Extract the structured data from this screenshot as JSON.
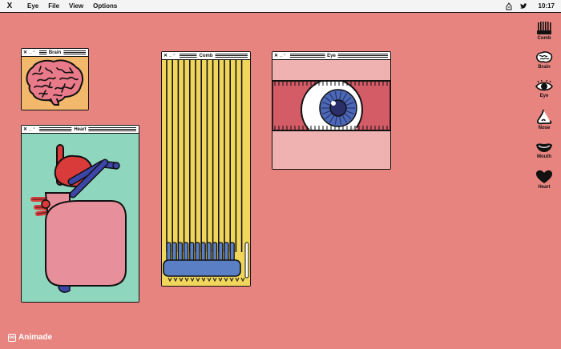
{
  "menubar": {
    "logo_glyph": "X",
    "menus": [
      "Eye",
      "File",
      "View",
      "Options"
    ],
    "clock": "10:17",
    "icons": [
      "recycle-icon",
      "twitter-icon"
    ]
  },
  "windows": {
    "brain": {
      "title": "Brain"
    },
    "heart": {
      "title": "Heart"
    },
    "comb": {
      "title": "Comb"
    },
    "eye": {
      "title": "Eye"
    }
  },
  "dock": {
    "items": [
      {
        "label": "Comb",
        "icon": "comb-icon"
      },
      {
        "label": "Brain",
        "icon": "brain-icon"
      },
      {
        "label": "Eye",
        "icon": "eye-icon"
      },
      {
        "label": "Nose",
        "icon": "nose-icon"
      },
      {
        "label": "Mouth",
        "icon": "mouth-icon"
      },
      {
        "label": "Heart",
        "icon": "heart-icon"
      }
    ]
  },
  "brand": {
    "name": "Animade",
    "mark": "oo"
  },
  "colors": {
    "desktop": "#e8847f",
    "brain_bg": "#f2b86b",
    "brain": "#e97a8a",
    "heart_bg": "#8fd6be",
    "heart_body": "#e88f9c",
    "heart_red": "#d93a3a",
    "vessel_blue": "#3b46a6",
    "comb_bg": "#f1d65c",
    "comb_blue": "#5a7fc4",
    "eye_red": "#d45c66",
    "eye_pink": "#f0b1b1",
    "iris": "#4c69b7"
  }
}
